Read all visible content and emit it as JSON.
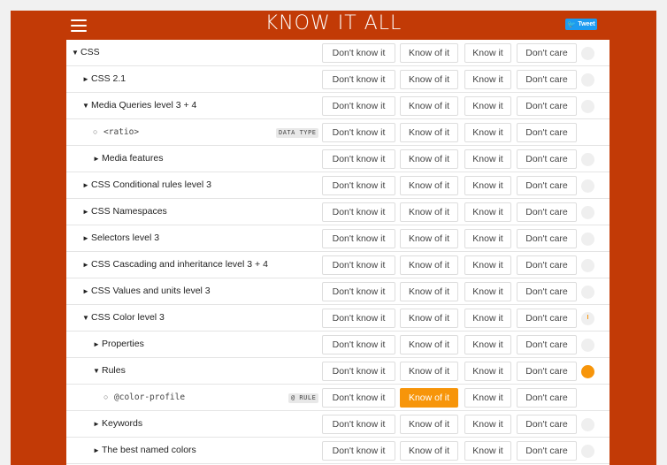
{
  "app": {
    "title": "KNOW IT ALL",
    "tweet_label": "Tweet"
  },
  "colors": {
    "background": "#c23a06",
    "accent": "#f7950a"
  },
  "buttons": {
    "dont_know": "Don't know it",
    "know_of": "Know of it",
    "know": "Know it",
    "dont_care": "Don't care"
  },
  "rows": [
    {
      "label": "CSS",
      "expander": "▼",
      "level": 0
    },
    {
      "label": "CSS 2.1",
      "expander": "►",
      "level": 1
    },
    {
      "label": "Media Queries level 3 + 4",
      "expander": "▼",
      "level": 1
    },
    {
      "label": "<ratio>",
      "bullet": "○",
      "badge": "DATA TYPE",
      "level": 2
    },
    {
      "label": "Media features",
      "expander": "►",
      "level": 2
    },
    {
      "label": "CSS Conditional rules level 3",
      "expander": "►",
      "level": 1
    },
    {
      "label": "CSS Namespaces",
      "expander": "►",
      "level": 1
    },
    {
      "label": "Selectors level 3",
      "expander": "►",
      "level": 1
    },
    {
      "label": "CSS Cascading and inheritance level 3 + 4",
      "expander": "►",
      "level": 1
    },
    {
      "label": "CSS Values and units level 3",
      "expander": "►",
      "level": 1
    },
    {
      "label": "CSS Color level 3",
      "expander": "▼",
      "level": 1,
      "progress": "partial"
    },
    {
      "label": "Properties",
      "expander": "►",
      "level": 2
    },
    {
      "label": "Rules",
      "expander": "▼",
      "level": 2,
      "progress": "full"
    },
    {
      "label": "@color-profile",
      "bullet": "○",
      "badge": "@ RULE",
      "level": 3,
      "selected": "know_of"
    },
    {
      "label": "Keywords",
      "expander": "►",
      "level": 2
    },
    {
      "label": "The best named colors",
      "expander": "►",
      "level": 2
    }
  ]
}
